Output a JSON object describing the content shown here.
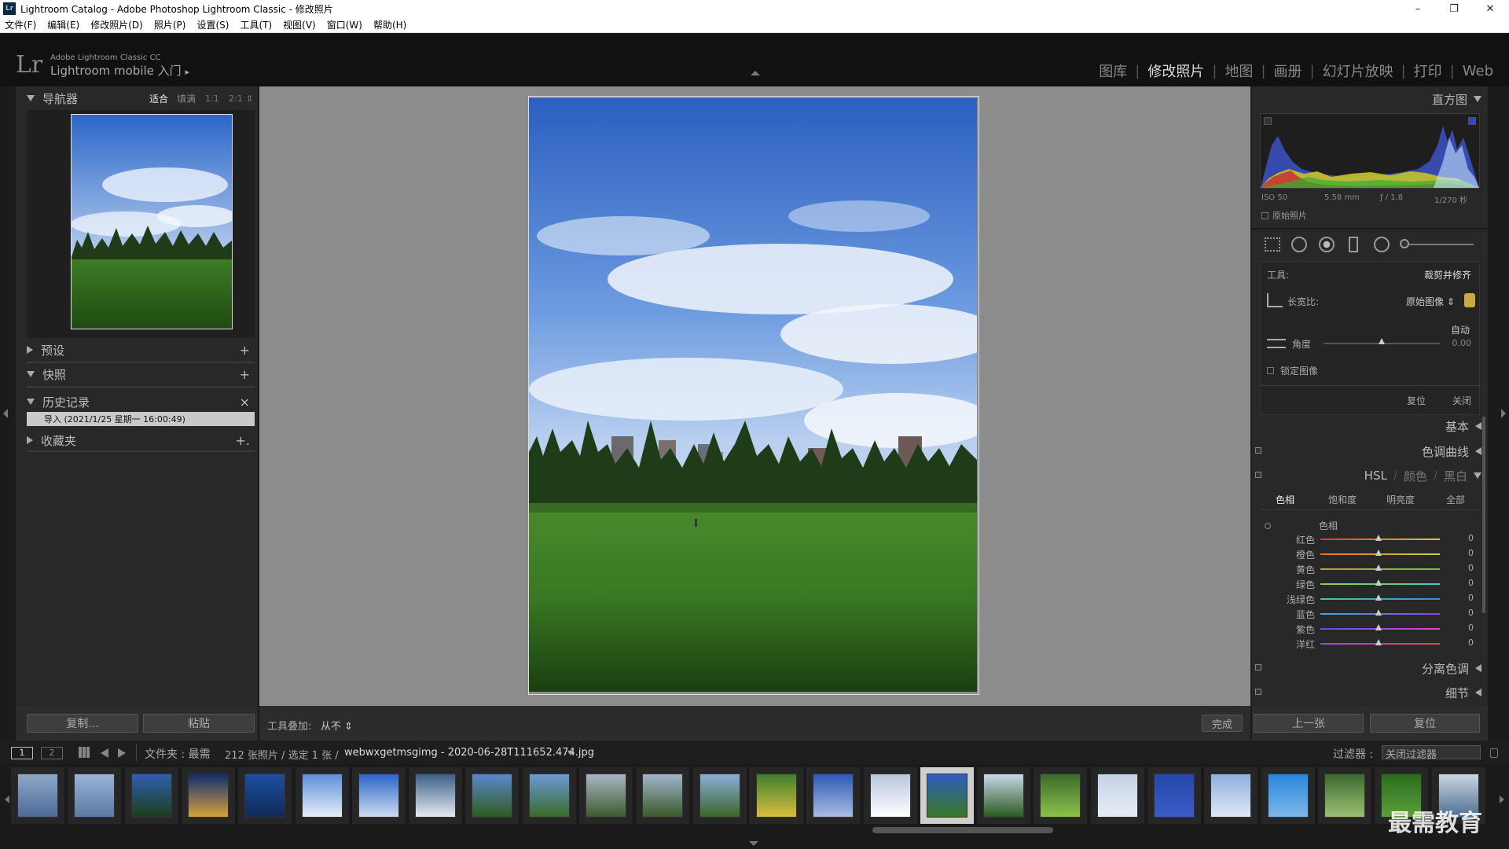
{
  "window": {
    "title": "Lightroom Catalog - Adobe Photoshop Lightroom Classic - 修改照片",
    "icon_text": "Lr",
    "min": "–",
    "max": "❐",
    "close": "✕"
  },
  "menu": [
    "文件(F)",
    "编辑(E)",
    "修改照片(D)",
    "照片(P)",
    "设置(S)",
    "工具(T)",
    "视图(V)",
    "窗口(W)",
    "帮助(H)"
  ],
  "identity": {
    "logo": "Lr",
    "line1": "Adobe Lightroom Classic CC",
    "line2": "Lightroom mobile 入门",
    "arrow": "▸"
  },
  "modules": {
    "items": [
      "图库",
      "修改照片",
      "地图",
      "画册",
      "幻灯片放映",
      "打印",
      "Web"
    ],
    "active_index": 1
  },
  "left": {
    "navigator": {
      "title": "导航器",
      "zoom": [
        "适合",
        "填满",
        "1:1",
        "2:1"
      ],
      "zoom_arrow": "⇕"
    },
    "presets": {
      "title": "预设",
      "action": "+"
    },
    "snapshots": {
      "title": "快照",
      "action": "+"
    },
    "history": {
      "title": "历史记录",
      "action": "×",
      "entry": "导入 (2021/1/25 星期一 16:00:49)"
    },
    "collections": {
      "title": "收藏夹",
      "action": "+."
    },
    "copy_btn": "复制...",
    "paste_btn": "粘贴"
  },
  "toolbar": {
    "overlay_label": "工具叠加:",
    "overlay_value": "从不",
    "overlay_arrow": "⇕",
    "done_btn": "完成"
  },
  "right": {
    "histogram": {
      "title": "直方图",
      "iso": "ISO 50",
      "focal": "5.58 mm",
      "aperture": "ƒ / 1.8",
      "shutter": "1/270 秒",
      "original_photo": "原始照片"
    },
    "crop": {
      "tool_label": "工具:",
      "tool_name": "裁剪并修齐",
      "aspect_label": "长宽比:",
      "aspect_value": "原始图像",
      "aspect_arrow": "⇕",
      "auto": "自动",
      "angle_label": "角度",
      "angle_value": "0.00",
      "constrain": "锁定图像",
      "reset": "复位",
      "close": "关闭"
    },
    "basic": "基本",
    "tone_curve": "色调曲线",
    "hsl": {
      "title": [
        "HSL",
        "颜色",
        "黑白"
      ],
      "tabs": [
        "色相",
        "饱和度",
        "明亮度",
        "全部"
      ],
      "group": "色相",
      "rows": [
        {
          "label": "红色",
          "value": "0",
          "c1": "#d33",
          "c2": "#cc4"
        },
        {
          "label": "橙色",
          "value": "0",
          "c1": "#d73",
          "c2": "#cc4"
        },
        {
          "label": "黄色",
          "value": "0",
          "c1": "#c93",
          "c2": "#6c4"
        },
        {
          "label": "绿色",
          "value": "0",
          "c1": "#9c4",
          "c2": "#4cb"
        },
        {
          "label": "浅绿色",
          "value": "0",
          "c1": "#4c8",
          "c2": "#48d"
        },
        {
          "label": "蓝色",
          "value": "0",
          "c1": "#4ac",
          "c2": "#84d"
        },
        {
          "label": "紫色",
          "value": "0",
          "c1": "#55d",
          "c2": "#d4c"
        },
        {
          "label": "洋红",
          "value": "0",
          "c1": "#a4d",
          "c2": "#d44"
        }
      ]
    },
    "split_toning": "分离色调",
    "detail": "细节",
    "prev_btn": "上一张",
    "reset_btn": "复位"
  },
  "filmhead": {
    "view1": "1",
    "view2": "2",
    "source": "文件夹 : 最需",
    "count": "212 张照片 / 选定 1 张 /",
    "filename": "webwxgetmsgimg - 2020-06-28T111652.474.jpg",
    "filter_label": "过滤器 :",
    "filter_value": "关闭过滤器"
  },
  "watermark": "最需教育"
}
